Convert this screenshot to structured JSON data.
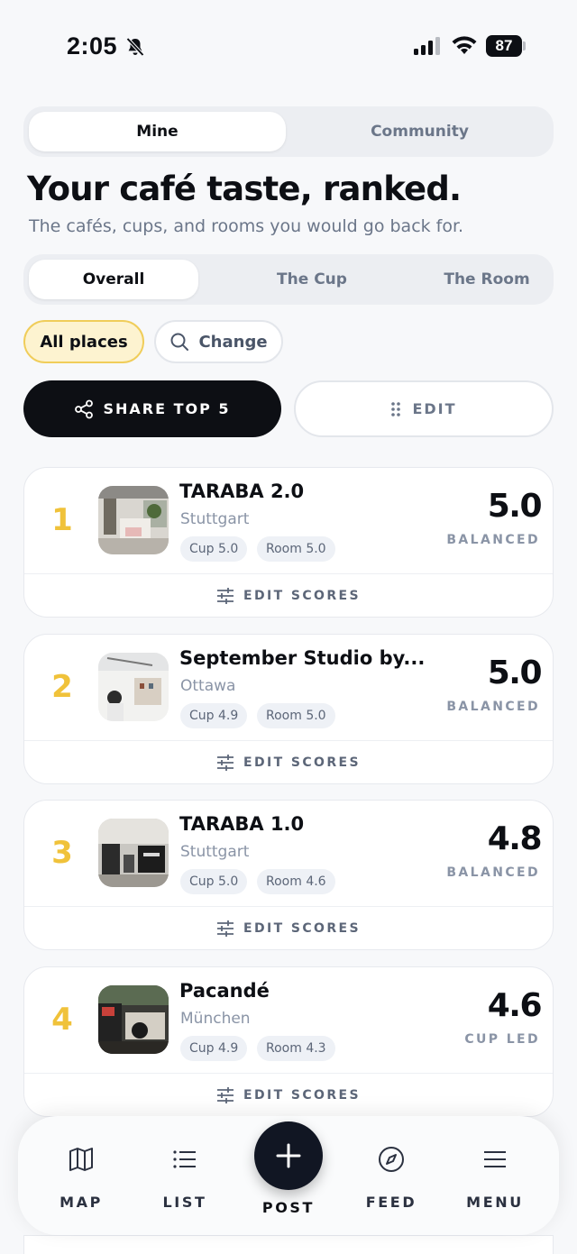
{
  "status_bar": {
    "time": "2:05",
    "battery": "87"
  },
  "scope_tabs": [
    {
      "label": "Mine",
      "active": true
    },
    {
      "label": "Community",
      "active": false
    }
  ],
  "header": {
    "title": "Your café taste, ranked.",
    "subtitle": "The cafés, cups, and rooms you would go back for."
  },
  "rank_tabs": [
    {
      "label": "Overall",
      "active": true
    },
    {
      "label": "The Cup",
      "active": false
    },
    {
      "label": "The Room",
      "active": false
    }
  ],
  "filters": {
    "all_places": "All places",
    "change": "Change"
  },
  "actions": {
    "share": "SHARE TOP 5",
    "edit": "EDIT"
  },
  "cafes": [
    {
      "rank": "1",
      "name": "TARABA 2.0",
      "city": "Stuttgart",
      "cup": "Cup 5.0",
      "room": "Room 5.0",
      "score": "5.0",
      "label": "BALANCED",
      "edit": "EDIT SCORES"
    },
    {
      "rank": "2",
      "name": "September Studio by...",
      "city": "Ottawa",
      "cup": "Cup 4.9",
      "room": "Room 5.0",
      "score": "5.0",
      "label": "BALANCED",
      "edit": "EDIT SCORES"
    },
    {
      "rank": "3",
      "name": "TARABA 1.0",
      "city": "Stuttgart",
      "cup": "Cup 5.0",
      "room": "Room 4.6",
      "score": "4.8",
      "label": "BALANCED",
      "edit": "EDIT SCORES"
    },
    {
      "rank": "4",
      "name": "Pacandé",
      "city": "München",
      "cup": "Cup 4.9",
      "room": "Room 4.3",
      "score": "4.6",
      "label": "CUP LED",
      "edit": "EDIT SCORES"
    }
  ],
  "nav": {
    "map": "MAP",
    "list": "LIST",
    "post": "POST",
    "feed": "FEED",
    "menu": "MENU"
  },
  "colors": {
    "rank_gold": "#f0c23a",
    "dark": "#0d0f14",
    "muted": "#6b7689"
  }
}
